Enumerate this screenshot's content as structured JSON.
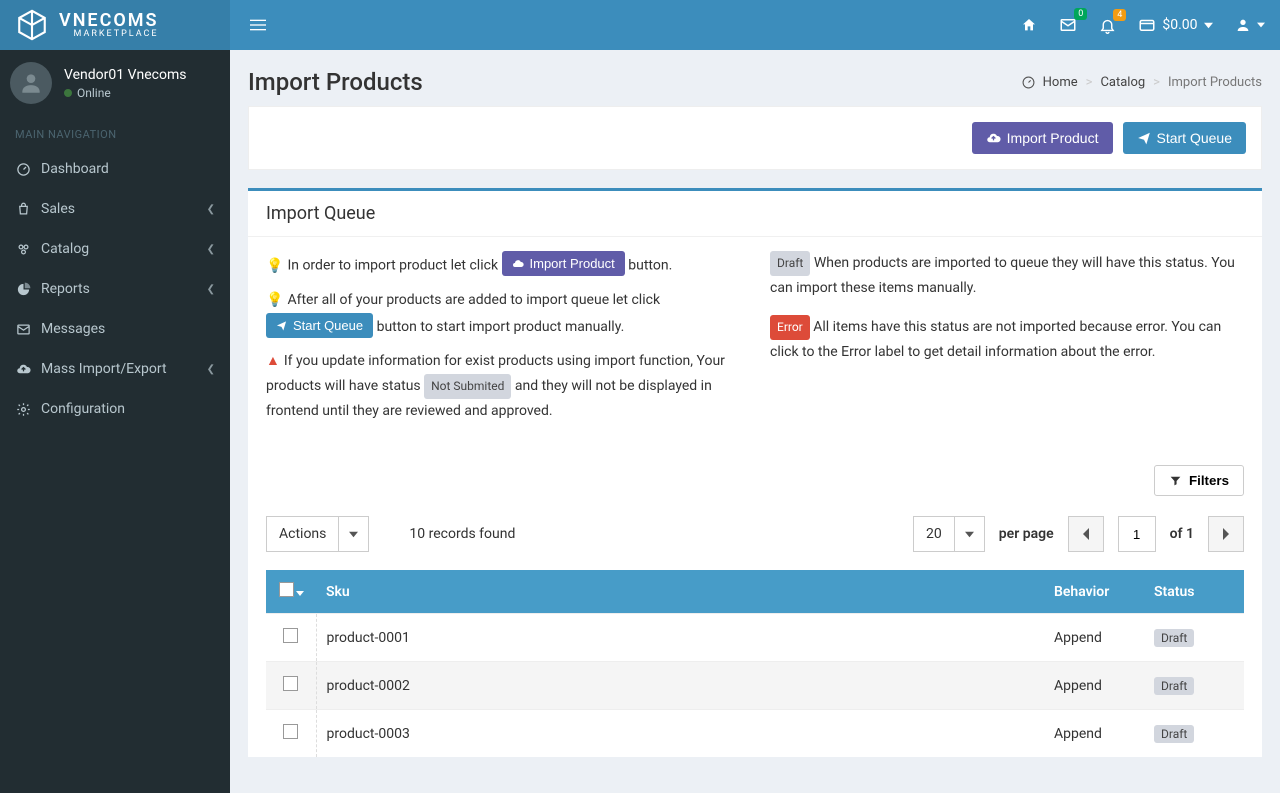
{
  "brand": {
    "name": "VNECOMS",
    "sub": "MARKETPLACE"
  },
  "user": {
    "name": "Vendor01 Vnecoms",
    "status": "Online"
  },
  "nav": {
    "header": "MAIN NAVIGATION",
    "items": [
      {
        "label": "Dashboard",
        "expandable": false
      },
      {
        "label": "Sales",
        "expandable": true
      },
      {
        "label": "Catalog",
        "expandable": true
      },
      {
        "label": "Reports",
        "expandable": true
      },
      {
        "label": "Messages",
        "expandable": false
      },
      {
        "label": "Mass Import/Export",
        "expandable": true
      },
      {
        "label": "Configuration",
        "expandable": false
      }
    ]
  },
  "topbar": {
    "msg_count": "0",
    "notif_count": "4",
    "balance": "$0.00"
  },
  "page": {
    "title": "Import Products",
    "breadcrumb": {
      "home": "Home",
      "catalog": "Catalog",
      "current": "Import Products"
    },
    "actions": {
      "import": "Import Product",
      "start_queue": "Start Queue"
    }
  },
  "panel": {
    "title": "Import Queue",
    "tip1_a": "In order to import product let click ",
    "tip1_btn": "Import Product",
    "tip1_b": " button.",
    "tip2_a": "After all of your products are added to import queue let click ",
    "tip2_btn": "Start Queue",
    "tip2_b": " button to start import product manually.",
    "warn_a": "If you update information for exist products using import function, Your products will have status ",
    "warn_pill": "Not Submited",
    "warn_b": " and they will not be displayed in frontend until they are reviewed and approved.",
    "draft_label": "Draft",
    "draft_text": "When products are imported to queue they will have this status. You can import these items manually.",
    "error_label": "Error",
    "error_text": "All items have this status are not imported because error. You can click to the Error label to get detail information about the error."
  },
  "grid": {
    "filters": "Filters",
    "actions": "Actions",
    "records": "10 records found",
    "per_page_value": "20",
    "per_page_label": "per page",
    "page": "1",
    "of": "of 1",
    "headers": {
      "sku": "Sku",
      "behavior": "Behavior",
      "status": "Status"
    },
    "rows": [
      {
        "sku": "product-0001",
        "behavior": "Append",
        "status": "Draft"
      },
      {
        "sku": "product-0002",
        "behavior": "Append",
        "status": "Draft"
      },
      {
        "sku": "product-0003",
        "behavior": "Append",
        "status": "Draft"
      }
    ]
  }
}
